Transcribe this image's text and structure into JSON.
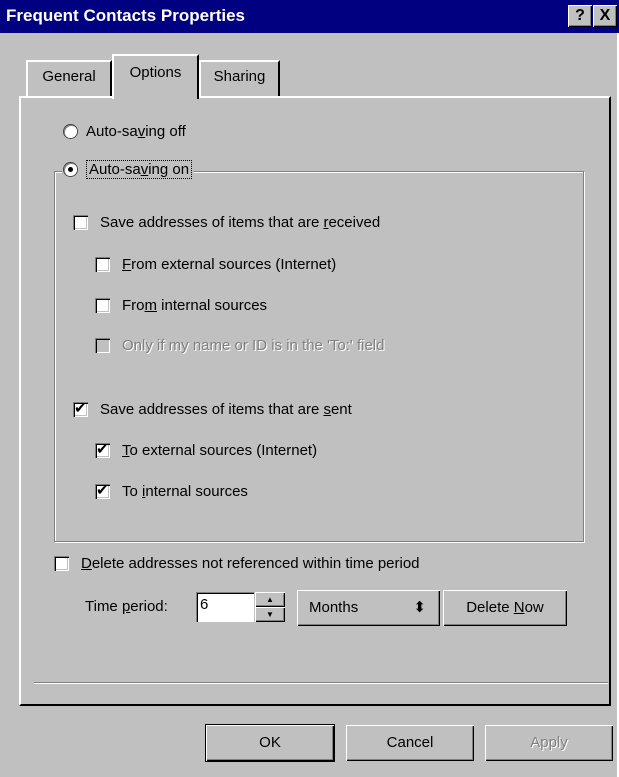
{
  "window": {
    "title": "Frequent Contacts Properties",
    "help_label": "?",
    "close_label": "X"
  },
  "tabs": [
    {
      "label": "General",
      "active": false
    },
    {
      "label": "Options",
      "active": true
    },
    {
      "label": "Sharing",
      "active": false
    }
  ],
  "options": {
    "radio_off": {
      "label": "Auto-saving off",
      "checked": false
    },
    "radio_on": {
      "label": "Auto-saving on",
      "checked": true
    },
    "received": {
      "label": "Save addresses of items that are received",
      "checked": false,
      "external": {
        "label": "From external sources (Internet)",
        "checked": false
      },
      "internal": {
        "label": "From internal sources",
        "checked": false
      },
      "only_if": {
        "label": "Only if my name or ID is in the 'To:' field",
        "checked": false,
        "disabled": true
      }
    },
    "sent": {
      "label": "Save addresses of items that are sent",
      "checked": true,
      "external": {
        "label": "To external sources (Internet)",
        "checked": true
      },
      "internal": {
        "label": "To internal sources",
        "checked": true
      }
    },
    "delete": {
      "label": "Delete addresses not referenced within time period",
      "checked": false
    },
    "time_period": {
      "label": "Time period:",
      "value": "6",
      "unit": "Months",
      "delete_now_label": "Delete Now"
    }
  },
  "buttons": {
    "ok": "OK",
    "cancel": "Cancel",
    "apply": "Apply"
  }
}
